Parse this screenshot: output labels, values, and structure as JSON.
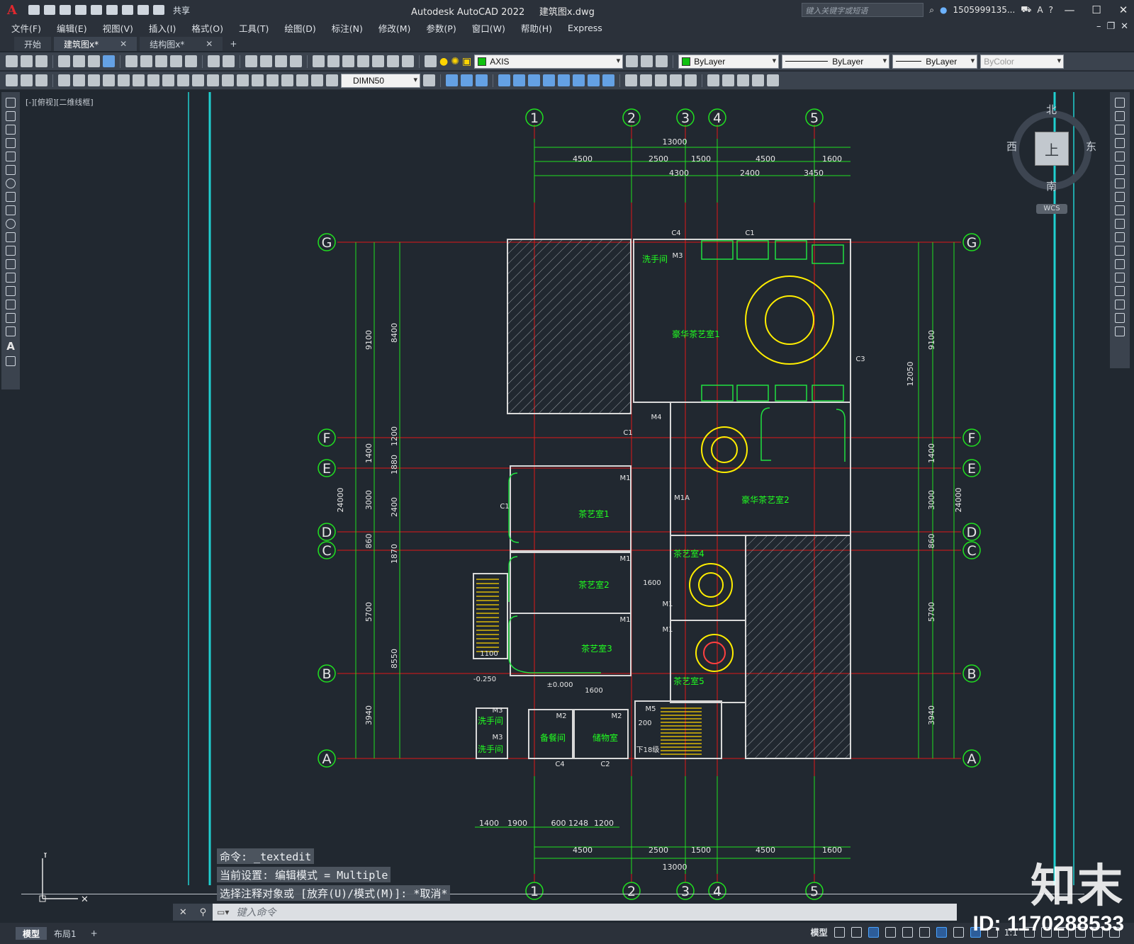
{
  "app": {
    "title": "Autodesk AutoCAD 2022",
    "filename": "建筑图x.dwg",
    "logo": "A",
    "share_label": "共享",
    "search_placeholder": "键入关键字或短语",
    "user": "1505999135...",
    "accent": "#e0282e"
  },
  "menu": [
    "文件(F)",
    "编辑(E)",
    "视图(V)",
    "插入(I)",
    "格式(O)",
    "工具(T)",
    "绘图(D)",
    "标注(N)",
    "修改(M)",
    "参数(P)",
    "窗口(W)",
    "帮助(H)",
    "Express"
  ],
  "tabs": [
    {
      "label": "开始",
      "active": false
    },
    {
      "label": "建筑图x*",
      "active": true
    },
    {
      "label": "结构图x*",
      "active": false
    }
  ],
  "toolbar": {
    "layer": "AXIS",
    "color": "ByLayer",
    "linetype": "ByLayer",
    "lineweight": "ByLayer",
    "plotstyle": "ByColor",
    "dimstyle": "DIMN50"
  },
  "viewport_label": "[-][俯视][二维线框]",
  "viewcube": {
    "north": "北",
    "south": "南",
    "east": "东",
    "west": "西",
    "top": "上",
    "wcs": "WCS"
  },
  "drawing": {
    "axes_top": [
      "1",
      "2",
      "3",
      "4",
      "5"
    ],
    "axes_side": [
      "G",
      "F",
      "E",
      "D",
      "C",
      "B",
      "A"
    ],
    "dims_top_total": "13000",
    "dims_top_row1": [
      "4500",
      "2500",
      "1500",
      "4500",
      "1600"
    ],
    "dims_top_row2": [
      "4300",
      "2400",
      "3450"
    ],
    "dims_bottom_row1": [
      "4500",
      "2500",
      "1500",
      "4500",
      "1600"
    ],
    "dims_bottom_total": "13000",
    "dims_bottom_detail": [
      "1400",
      "1900",
      "600",
      "1248",
      "1200"
    ],
    "dims_left_outer": [
      "9100",
      "1400",
      "3000",
      "860",
      "5700",
      "3940"
    ],
    "dims_left_inner": [
      "8400",
      "1200",
      "1880",
      "2400",
      "1870",
      "8550"
    ],
    "dims_left_total": "24000",
    "dims_right": [
      "9100",
      "1400",
      "3000",
      "860",
      "5700",
      "3940"
    ],
    "dims_right_inner": "12050",
    "dims_right_total": "24000",
    "rooms": [
      "豪华茶艺室1",
      "豪华茶艺室2",
      "茶艺室1",
      "茶艺室2",
      "茶艺室3",
      "茶艺室4",
      "茶艺室5",
      "洗手间",
      "洗手间",
      "洗手间",
      "备餐间",
      "储物室"
    ],
    "tags": [
      "C4",
      "C1",
      "C3",
      "C1",
      "C1",
      "M3",
      "M4",
      "M1",
      "M1A",
      "M1",
      "M1",
      "M1",
      "M1",
      "M2",
      "M2",
      "M5",
      "M3",
      "M3",
      "C4",
      "C2",
      "1600",
      "1100",
      "1600",
      "200",
      "下18级",
      "-0.250",
      "±0.000"
    ]
  },
  "command": {
    "line1": "命令:  _textedit",
    "line2": "当前设置: 编辑模式 = Multiple",
    "line3": "选择注释对象或 [放弃(U)/模式(M)]: *取消*",
    "input_placeholder": "键入命令"
  },
  "status": {
    "tabs": [
      "模型",
      "布局1"
    ],
    "model_label": "模型",
    "scale": "1:1"
  },
  "watermark": {
    "brand": "知末",
    "id": "ID: 1170288533"
  }
}
